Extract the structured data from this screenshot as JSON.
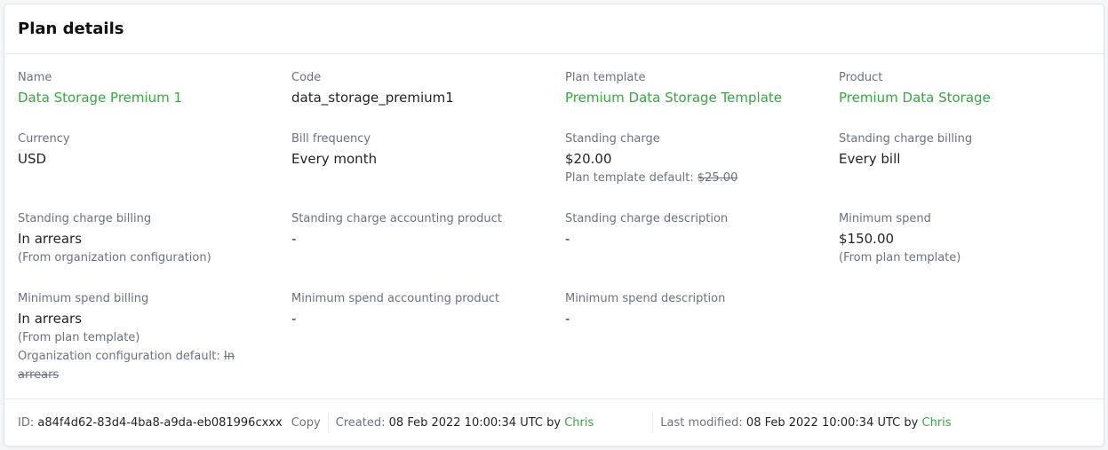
{
  "card": {
    "title": "Plan details"
  },
  "fields": {
    "name": {
      "label": "Name",
      "value": "Data Storage Premium 1"
    },
    "code": {
      "label": "Code",
      "value": "data_storage_premium1"
    },
    "plan_template": {
      "label": "Plan template",
      "value": "Premium Data Storage Template"
    },
    "product": {
      "label": "Product",
      "value": "Premium Data Storage"
    },
    "currency": {
      "label": "Currency",
      "value": "USD"
    },
    "bill_frequency": {
      "label": "Bill frequency",
      "value": "Every month"
    },
    "standing_charge": {
      "label": "Standing charge",
      "value": "$20.00",
      "default_prefix": "Plan template default: ",
      "default_value": "$25.00"
    },
    "standing_charge_billing_bill": {
      "label": "Standing charge billing",
      "value": "Every bill"
    },
    "standing_charge_billing": {
      "label": "Standing charge billing",
      "value": "In arrears",
      "note": "(From organization configuration)"
    },
    "standing_charge_accounting_product": {
      "label": "Standing charge accounting product",
      "value": "-"
    },
    "standing_charge_description": {
      "label": "Standing charge description",
      "value": "-"
    },
    "minimum_spend": {
      "label": "Minimum spend",
      "value": "$150.00",
      "note": "(From plan template)"
    },
    "minimum_spend_billing": {
      "label": "Minimum spend billing",
      "value": "In arrears",
      "note": "(From plan template)",
      "default_prefix": "Organization configuration default: ",
      "default_value": "In arrears"
    },
    "minimum_spend_accounting_product": {
      "label": "Minimum spend accounting product",
      "value": "-"
    },
    "minimum_spend_description": {
      "label": "Minimum spend description",
      "value": "-"
    }
  },
  "footer": {
    "id_label": "ID:",
    "id_value": "a84f4d62-83d4-4ba8-a9da-eb081996cxxx",
    "copy_label": "Copy",
    "created_label": "Created:",
    "created_value": "08 Feb 2022 10:00:34 UTC",
    "by_label": "by",
    "created_by": "Chris",
    "modified_label": "Last modified:",
    "modified_value": "08 Feb 2022 10:00:34 UTC",
    "modified_by": "Chris"
  },
  "colors": {
    "link": "#3aa546",
    "label": "#6b7280",
    "border": "#e3e6ea"
  }
}
